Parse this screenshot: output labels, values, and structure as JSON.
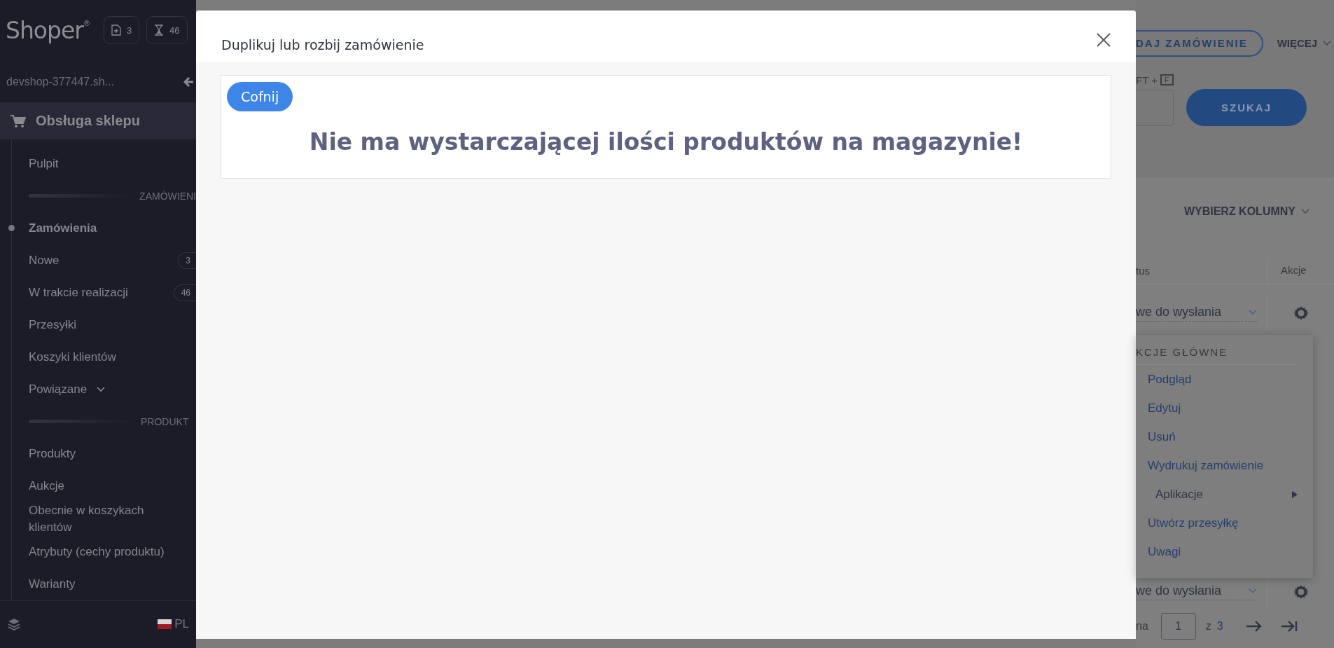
{
  "sidebar": {
    "logo": "Shoper",
    "logo_mark": "®",
    "counters": [
      {
        "kind": "new",
        "value": "3"
      },
      {
        "kind": "pending",
        "value": "46"
      }
    ],
    "shop": "devshop-377447.sh...",
    "section": "Obsługa sklepu",
    "items": [
      {
        "kind": "link",
        "label": "Pulpit",
        "selected": false
      },
      {
        "kind": "heading",
        "label": "ZAMÓWIENI"
      },
      {
        "kind": "link",
        "label": "Zamówienia",
        "selected": true
      },
      {
        "kind": "link",
        "label": "Nowe",
        "badge": "3",
        "selected": false
      },
      {
        "kind": "link",
        "label": "W trakcie realizacji",
        "badge": "46",
        "selected": false
      },
      {
        "kind": "link",
        "label": "Przesyłki",
        "selected": false
      },
      {
        "kind": "link",
        "label": "Koszyki klientów",
        "selected": false
      },
      {
        "kind": "link",
        "label": "Powiązane",
        "expandable": true,
        "selected": false
      },
      {
        "kind": "heading",
        "label": "PRODUKT"
      },
      {
        "kind": "link",
        "label": "Produkty",
        "selected": false
      },
      {
        "kind": "link",
        "label": "Aukcje",
        "selected": false
      },
      {
        "kind": "link",
        "label": "Obecnie w koszykach klientów",
        "selected": false
      },
      {
        "kind": "link",
        "label": "Atrybuty (cechy produktu)",
        "selected": false
      },
      {
        "kind": "link",
        "label": "Warianty",
        "selected": false
      }
    ],
    "language": "PL"
  },
  "modal": {
    "title": "Duplikuj lub rozbij zamówienie",
    "back_button": "Cofnij",
    "message": "Nie ma wystarczającej ilości produktów na magazynie!"
  },
  "background": {
    "add_order_button": "DAJ ZAMÓWIENIE",
    "more_menu": "WIĘCEJ",
    "shortcut": "FT +",
    "shortcut_key": "F",
    "search_button": "SZUKAJ",
    "columns_button": "WYBIERZ KOLUMNY",
    "table": {
      "columns": [
        "tus",
        "Akcje"
      ],
      "rows": [
        {
          "status": "we do wysłania"
        },
        {
          "status": "we do wysłania"
        }
      ]
    },
    "actions_menu": {
      "heading": "KCJE GŁÓWNE",
      "items": [
        {
          "kind": "link",
          "label": "Podgląd"
        },
        {
          "kind": "link",
          "label": "Edytuj"
        },
        {
          "kind": "link",
          "label": "Usuń"
        },
        {
          "kind": "link",
          "label": "Wydrukuj zamówienie"
        },
        {
          "kind": "submenu",
          "label": "Aplikacje"
        },
        {
          "kind": "link",
          "label": "Utwórz przesyłkę"
        },
        {
          "kind": "link",
          "label": "Uwagi"
        }
      ]
    },
    "pagination": {
      "label": "na",
      "page": "1",
      "of": "z",
      "total": "3"
    }
  }
}
